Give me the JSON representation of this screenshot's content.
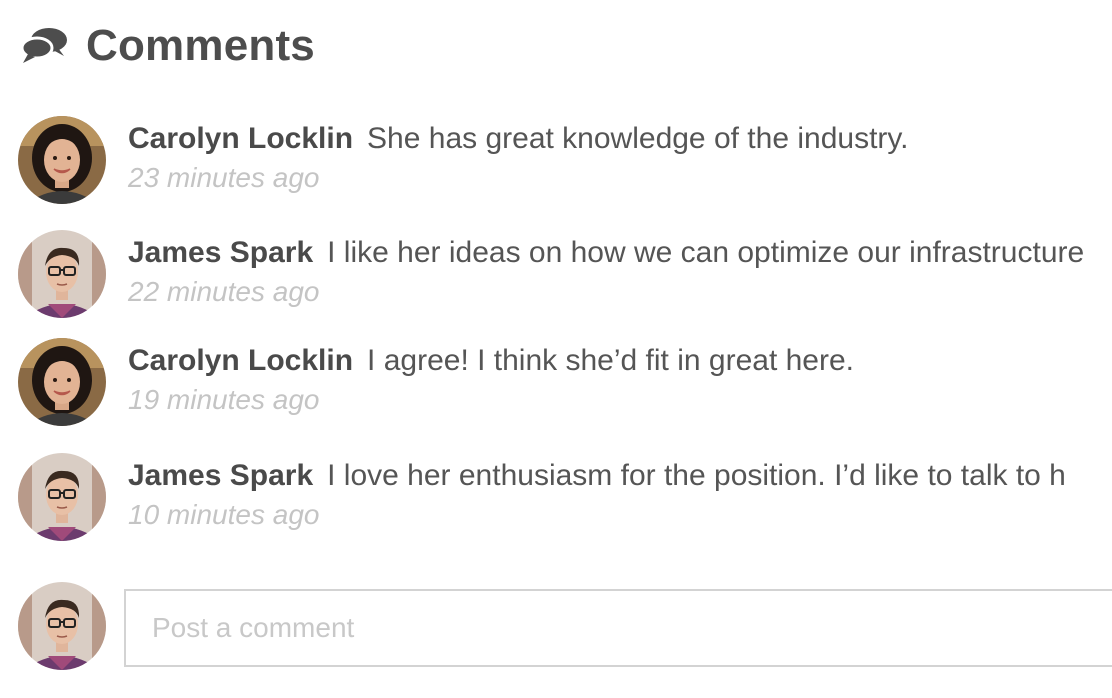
{
  "header": {
    "icon": "comments-icon",
    "title": "Comments"
  },
  "colors": {
    "title": "#4d4d4d",
    "author": "#4a4a4a",
    "text": "#555555",
    "timestamp": "#c4c4c4",
    "input_border": "#d3d3d3"
  },
  "comments": [
    {
      "author": "Carolyn Locklin",
      "avatar": "avatar-carolyn",
      "text": "She has great knowledge of the industry.",
      "time": "23 minutes ago"
    },
    {
      "author": "James Spark",
      "avatar": "avatar-james",
      "text": "I like her ideas on how we can optimize our infrastructure",
      "time": "22 minutes ago"
    },
    {
      "author": "Carolyn Locklin",
      "avatar": "avatar-carolyn",
      "text": "I agree! I think she’d fit in great here.",
      "time": "19 minutes ago"
    },
    {
      "author": "James Spark",
      "avatar": "avatar-james",
      "text": "I love her enthusiasm for the position. I’d like to talk to h",
      "time": "10 minutes ago"
    }
  ],
  "composer": {
    "avatar": "avatar-james",
    "placeholder": "Post a comment",
    "value": ""
  }
}
